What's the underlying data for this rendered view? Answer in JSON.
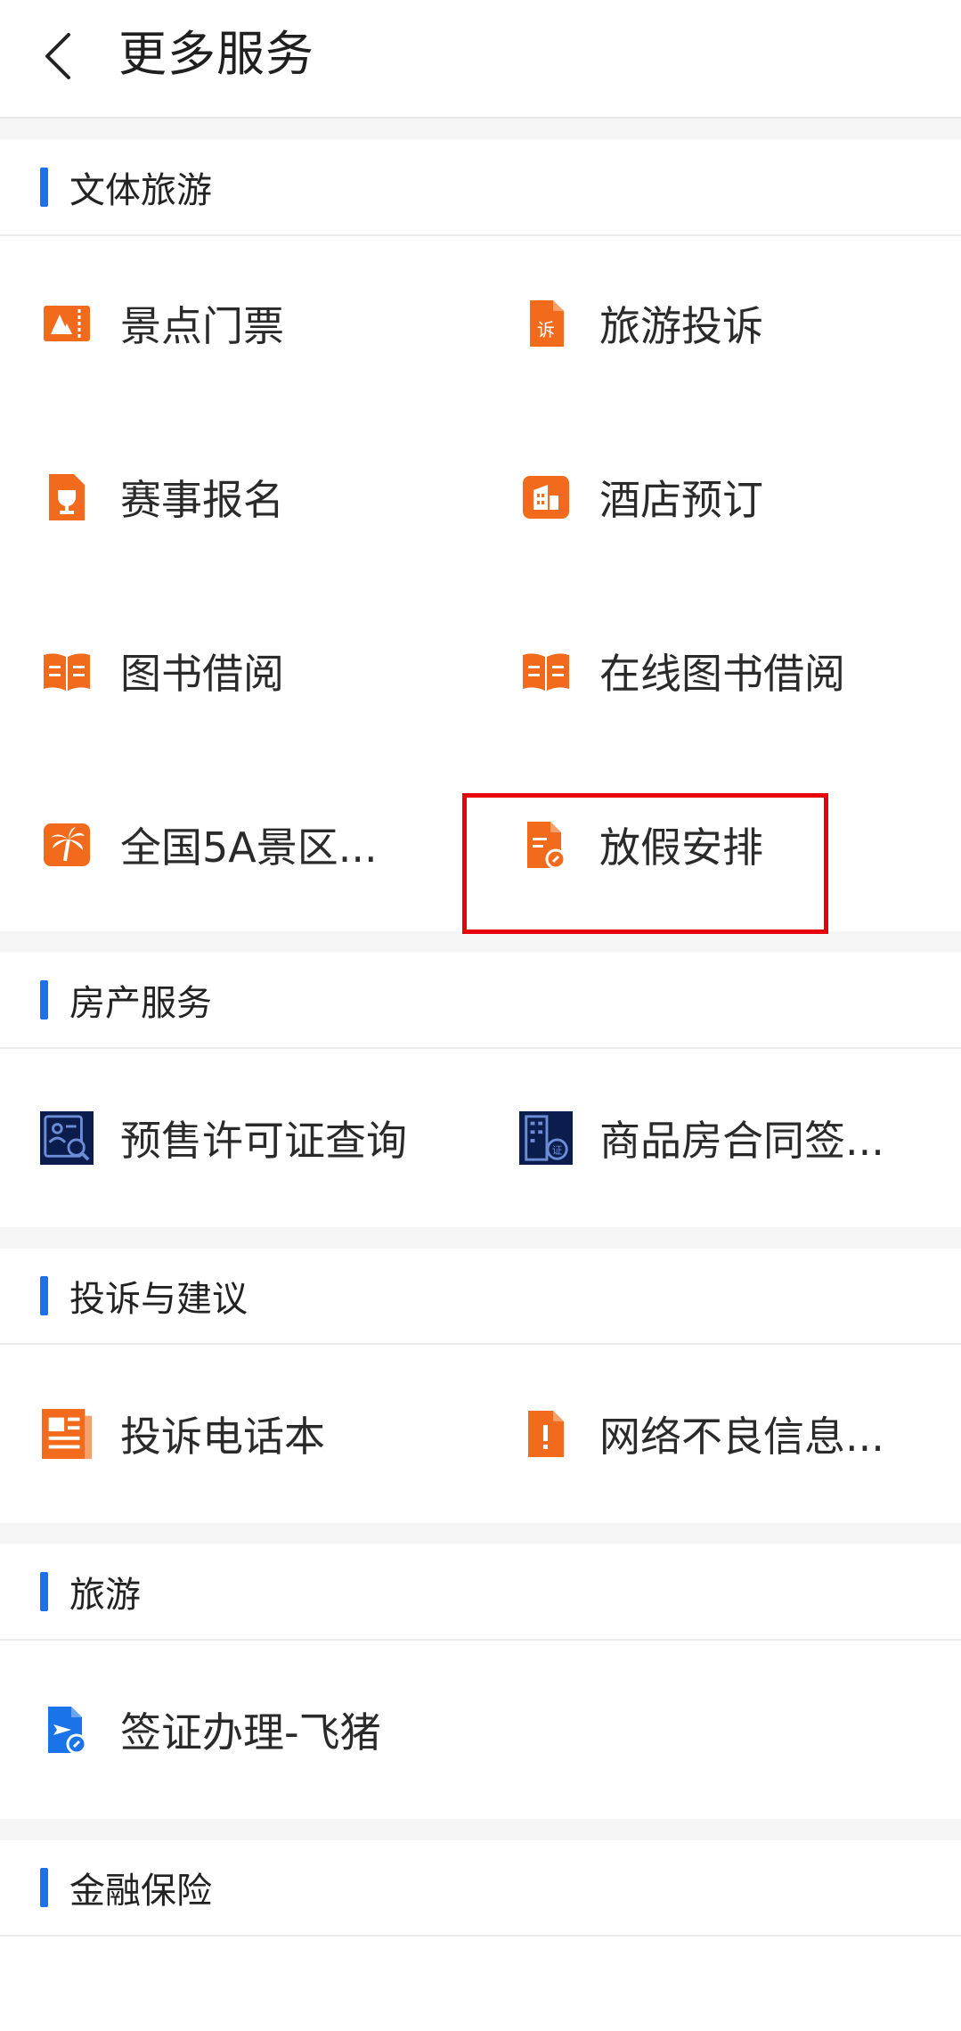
{
  "header": {
    "title": "更多服务",
    "back_icon": "chevron-left-icon"
  },
  "sections": [
    {
      "title": "文体旅游",
      "items": [
        {
          "label": "景点门票",
          "icon": "ticket-icon"
        },
        {
          "label": "旅游投诉",
          "icon": "complaint-doc-icon"
        },
        {
          "label": "赛事报名",
          "icon": "trophy-doc-icon"
        },
        {
          "label": "酒店预订",
          "icon": "hotel-icon"
        },
        {
          "label": "图书借阅",
          "icon": "book-icon"
        },
        {
          "label": "在线图书借阅",
          "icon": "book-icon"
        },
        {
          "label": "全国5A景区...",
          "icon": "palm-tree-icon"
        },
        {
          "label": "放假安排",
          "icon": "schedule-doc-icon"
        }
      ]
    },
    {
      "title": "房产服务",
      "items": [
        {
          "label": "预售许可证查询",
          "icon": "license-search-icon"
        },
        {
          "label": "商品房合同签...",
          "icon": "building-certificate-icon"
        }
      ]
    },
    {
      "title": "投诉与建议",
      "items": [
        {
          "label": "投诉电话本",
          "icon": "newspaper-icon"
        },
        {
          "label": "网络不良信息...",
          "icon": "alert-doc-icon"
        }
      ]
    },
    {
      "title": "旅游",
      "items": [
        {
          "label": "签证办理-飞猪",
          "icon": "flight-doc-icon"
        }
      ]
    },
    {
      "title": "金融保险",
      "items": []
    }
  ],
  "colors": {
    "accent_blue": "#1a73e8",
    "icon_orange": "#f26a1b",
    "icon_navy": "#0b1d4d",
    "highlight_red": "#e8000b",
    "divider": "#ececec",
    "gap_bg": "#f5f5f5"
  }
}
